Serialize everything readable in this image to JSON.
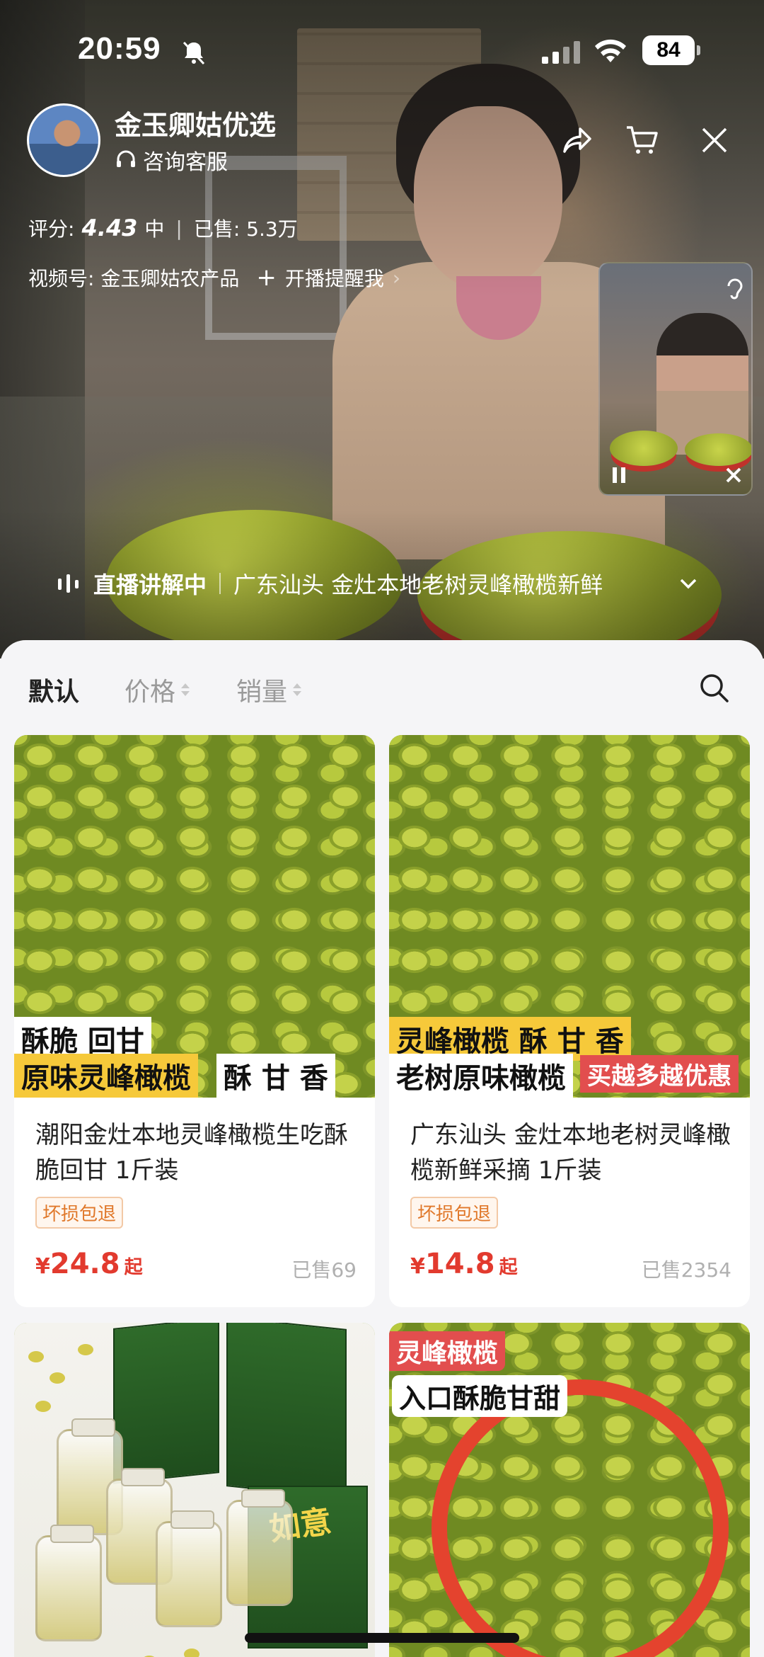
{
  "status_bar": {
    "time": "20:59",
    "battery": "84"
  },
  "shop": {
    "name": "金玉卿姑优选",
    "service": "咨询客服",
    "rating_label": "评分:",
    "rating_score": "4.43",
    "rating_level": "中",
    "sold_label": "已售: 5.3万",
    "channel": "视频号: 金玉卿姑农产品",
    "remind": "开播提醒我"
  },
  "live": {
    "label": "直播讲解中",
    "title": "广东汕头 金灶本地老树灵峰橄榄新鲜"
  },
  "sort": {
    "default": "默认",
    "price": "价格",
    "sales": "销量"
  },
  "products": [
    {
      "name": "潮阳金灶本地灵峰橄榄生吃酥脆回甘 1斤装",
      "badge": "坏损包退",
      "currency": "¥",
      "price": "24.8",
      "suffix": "起",
      "sold": "已售69",
      "img_text_1": "酥脆 回甘",
      "img_text_2": "原味灵峰橄榄",
      "img_text_3": "酥 甘 香"
    },
    {
      "name": "广东汕头 金灶本地老树灵峰橄榄新鲜采摘 1斤装",
      "badge": "坏损包退",
      "currency": "¥",
      "price": "14.8",
      "suffix": "起",
      "sold": "已售2354",
      "img_text_1": "灵峰橄榄 酥 甘 香",
      "img_text_2": "老树原味橄榄",
      "img_text_3": "买越多越优惠"
    },
    {
      "img_label": "如意"
    },
    {
      "img_text_1": "灵峰橄榄",
      "img_text_2": "入口酥脆甘甜"
    }
  ],
  "colors": {
    "price": "#e23a2e",
    "badge": "#e0782a"
  }
}
